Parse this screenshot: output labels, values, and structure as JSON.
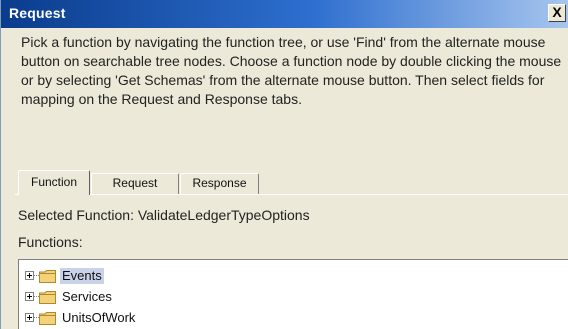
{
  "dialog": {
    "title": "Request",
    "close_label": "X"
  },
  "instructions": "Pick a function by navigating the function tree, or use 'Find' from the alternate mouse button on searchable tree nodes. Choose a function node by double clicking the mouse or by selecting 'Get Schemas' from the alternate mouse button. Then select fields for mapping on the Request and Response tabs.",
  "tabs": [
    {
      "label": "Function",
      "active": true
    },
    {
      "label": "Request",
      "active": false
    },
    {
      "label": "Response",
      "active": false
    }
  ],
  "selected_function": "Selected Function: ValidateLedgerTypeOptions",
  "functions_label": "Functions:",
  "tree": {
    "items": [
      {
        "label": "Events",
        "selected": true,
        "icon": "folder-icon"
      },
      {
        "label": "Services",
        "selected": false,
        "icon": "folder-icon"
      },
      {
        "label": "UnitsOfWork",
        "selected": false,
        "icon": "folder-icon"
      }
    ]
  },
  "colors": {
    "titlebar_start": "#0a3c8c",
    "titlebar_end": "#a8c6ee",
    "window_bg": "#ece9d8",
    "selection": "#c8d2e8",
    "folder": "#f4d27a"
  }
}
